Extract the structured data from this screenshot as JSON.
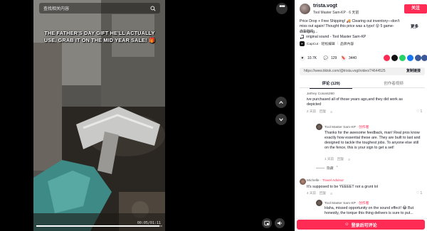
{
  "video": {
    "search_placeholder": "查找相关内容",
    "caption": "THE FATHER'S DAY GIFT HE'LL ACTUALLY USE. GRAB IT ON THE MID YEAR SALE! 🎁",
    "time": "00:05/01:11",
    "progress": 0.98
  },
  "header": {
    "username": "trista.vogt",
    "subline": "Tool Master Sam-KP · 6 天前",
    "follow_label": "关注"
  },
  "description": {
    "text": "Price Drop + Free Shipping! 🚚 Clearing out inventory—don't miss out again! Thought this price was a typo! 😲 5 game-changing...",
    "more": "更多",
    "translate": "查看翻译"
  },
  "sound": {
    "label": "original sound - Tool Master Sam-KP"
  },
  "capcut": {
    "label": "CapCut · 轻松编辑",
    "action": "品牌內容"
  },
  "actions": {
    "likes": "10.7K",
    "comments": "129",
    "saves": "3440",
    "share_colors": [
      "#fe2c55",
      "#111111",
      "#25d366",
      "#1877f2",
      "#3b5998",
      "#3b5998"
    ]
  },
  "share_url": {
    "url": "https://www.tiktok.com/@trista.vogt/video/7464452555...",
    "copy_label": "复制链接"
  },
  "tabs": {
    "comments": "评论 (129)",
    "creator_videos": "创作者视频"
  },
  "comments": [
    {
      "user": "Jeffrey Colon6290",
      "text": "ive purchased all of those years ago,and they did work as depicted",
      "time": "2 天前",
      "reply": "回复",
      "likes": "1",
      "reply_item": {
        "user": "Tool Master Sam-KP",
        "badge": "· 创作者",
        "text": "Thanks for the awesome feedback, man! Real pros know exactly how essential these are. They are built to last and designed to tackle the toughest jobs. To anyone else still on the fence, this is your sign to get a set!",
        "time": "1 天前",
        "reply": "回复"
      },
      "hide": "隐藏"
    },
    {
      "user": "Michelle",
      "badge": "· Travel Advisor",
      "text": "It's supposed to be YEEEET not a grunt lol",
      "time": "4 天前",
      "reply": "回复",
      "likes": "1",
      "reply_item": {
        "user": "Tool Master Sam-KP",
        "badge": "· 创作者",
        "text": "Haha, missed opportunity on the sound effect! 😂 But honestly, the torque this thing delivers is sure to put..."
      }
    }
  ],
  "login": {
    "label": "登录后可评论"
  }
}
